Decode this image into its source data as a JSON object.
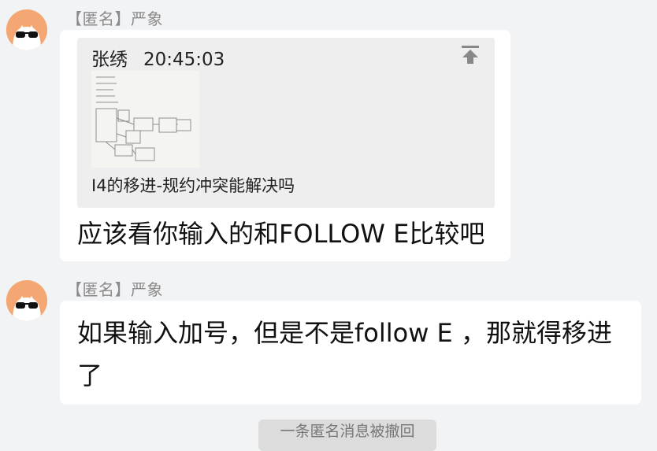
{
  "messages": [
    {
      "sender": "【匿名】严象",
      "quote": {
        "author": "张绣",
        "time": "20:45:03",
        "caption": "I4的移进-规约冲突能解决吗"
      },
      "text": "应该看你输入的和FOLLOW E比较吧"
    },
    {
      "sender": "【匿名】严象",
      "text": "如果输入加号，但是不是follow E ，那就得移进了"
    }
  ],
  "system_notice": "一条匿名消息被撤回",
  "icons": {
    "avatar": "anonymous-sunglasses-avatar",
    "jump": "jump-to-original-icon"
  },
  "colors": {
    "background": "#f2f3f5",
    "bubble": "#ffffff",
    "quote_bg": "#eeeeee",
    "avatar": "#f4a772",
    "sender_text": "#8a8a8a"
  }
}
